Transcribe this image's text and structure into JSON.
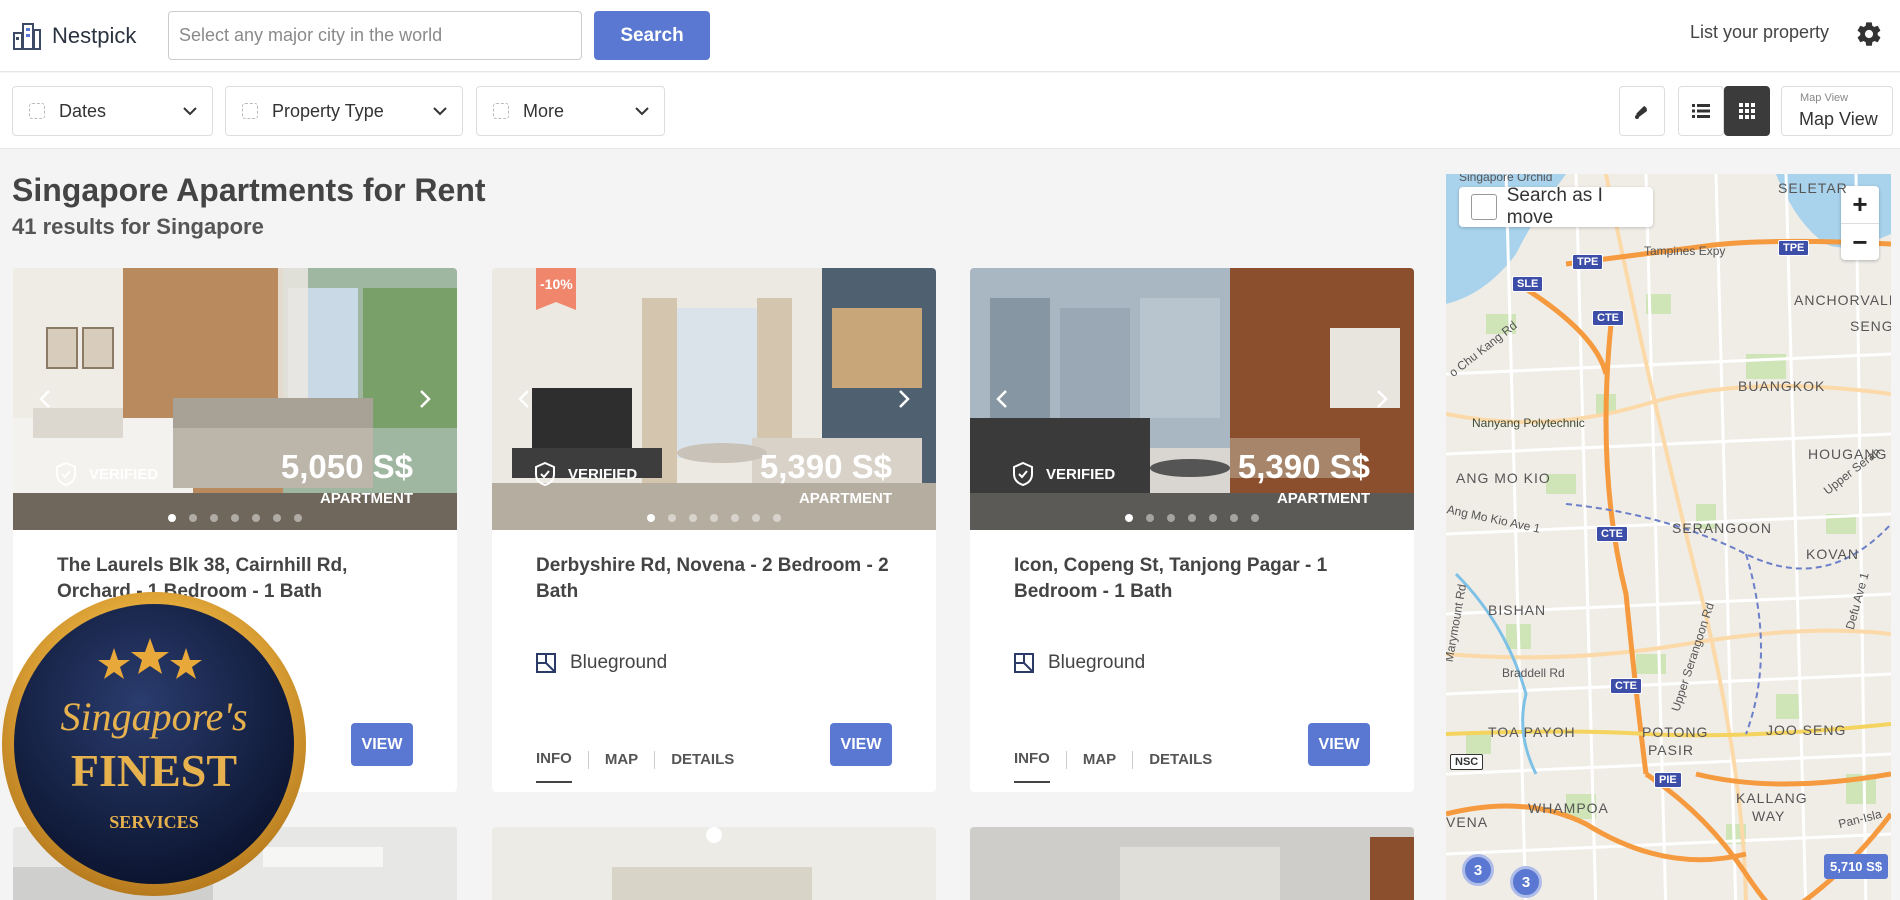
{
  "header": {
    "brand": "Nestpick",
    "search_placeholder": "Select any major city in the world",
    "search_label": "Search",
    "list_property": "List your property"
  },
  "filters": {
    "dates": "Dates",
    "property_type": "Property Type",
    "more": "More",
    "map_view_small": "Map View",
    "map_view": "Map View"
  },
  "results": {
    "title": "Singapore Apartments for Rent",
    "subtitle": "41 results for Singapore"
  },
  "cards": [
    {
      "title": "The Laurels Blk 38, Cairnhill Rd, Orchard - 1 Bedroom - 1 Bath",
      "price": "5,050 S$",
      "type": "APARTMENT",
      "verified": "VERIFIED",
      "provider": "",
      "discount": "",
      "view": "VIEW"
    },
    {
      "title": "Derbyshire Rd, Novena - 2 Bedroom - 2 Bath",
      "price": "5,390 S$",
      "type": "APARTMENT",
      "verified": "VERIFIED",
      "provider": "Blueground",
      "discount": "-10%",
      "view": "VIEW",
      "tabs": [
        "INFO",
        "MAP",
        "DETAILS"
      ]
    },
    {
      "title": "Icon, Copeng St, Tanjong Pagar - 1 Bedroom - 1 Bath",
      "price": "5,390 S$",
      "type": "APARTMENT",
      "verified": "VERIFIED",
      "provider": "Blueground",
      "discount": "",
      "view": "VIEW",
      "tabs": [
        "INFO",
        "MAP",
        "DETAILS"
      ]
    }
  ],
  "map": {
    "search_as_move": "Search as I move",
    "zoom_in": "+",
    "zoom_out": "−",
    "labels": {
      "orchid": "Singapore Orchid",
      "seletar": "SELETAR",
      "tampines": "Tampines Expy",
      "anchorvale": "ANCHORVALE",
      "sengka": "SENGKA",
      "chukang": "o Chu Kang Rd",
      "buangkok": "BUANGKOK",
      "nanyang": "Nanyang Polytechnic",
      "hougang": "HOUGANG",
      "angmokio": "ANG MO KIO",
      "amkave": "Ang Mo Kio Ave 1",
      "upperser": "Upper Seran",
      "serangoon": "SERANGOON",
      "kovan": "KOVAN",
      "bishan": "BISHAN",
      "marymount": "Marymount Rd",
      "deluave": "Defu Ave 1",
      "braddell": "Braddell Rd",
      "upserangoon": "Upper Serangoon Rd",
      "toapayoh": "TOA PAYOH",
      "potong": "POTONG",
      "pasir": "PASIR",
      "jooseng": "JOO SENG",
      "whampoa": "WHAMPOA",
      "kallang": "KALLANG",
      "way": "WAY",
      "venа": "VENA",
      "panisl": "Pan-Isla"
    },
    "shields": {
      "tpe1": "TPE",
      "tpe2": "TPE",
      "sle": "SLE",
      "cte1": "CTE",
      "cte2": "CTE",
      "cte3": "CTE",
      "nsc": "NSC",
      "pie": "PIE"
    },
    "clusters": [
      "3",
      "3"
    ],
    "price_pin": "5,710 S$"
  },
  "badge": {
    "script": "Singapore's",
    "finest": "FINEST",
    "services": "SERVICES"
  },
  "colors": {
    "accent": "#5a78d1",
    "badge_gold": "#e3a93a",
    "badge_navy": "#101c3a"
  }
}
